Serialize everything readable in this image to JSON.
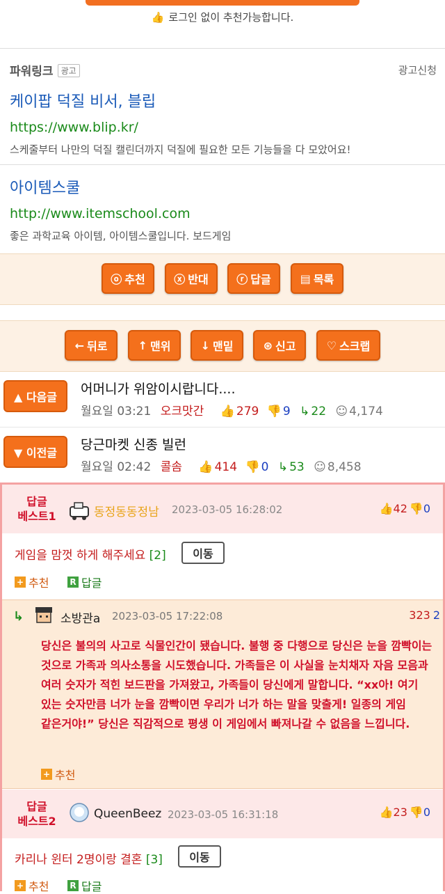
{
  "login_note": "로그인 없이 추천가능합니다.",
  "powerlink": {
    "title": "파워링크",
    "badge": "광고",
    "apply": "광고신청",
    "ads": [
      {
        "title": "케이팝 덕질 비서, 블립",
        "url": "https://www.blip.kr/",
        "desc": "스케줄부터 나만의 덕질 캘린더까지 덕질에 필요한 모든 기능들을 다 모았어요!"
      },
      {
        "title": "아이템스쿨",
        "url": "http://www.itemschool.com",
        "desc": "좋은 과학교육 아이템, 아이템스쿨입니다. 보드게임"
      }
    ]
  },
  "vote_buttons": [
    {
      "icon": "ⓞ",
      "label": "추천"
    },
    {
      "icon": "ⓧ",
      "label": "반대"
    },
    {
      "icon": "ⓡ",
      "label": "답글"
    },
    {
      "icon": "▤",
      "label": "목록"
    }
  ],
  "nav_buttons": [
    {
      "icon": "←",
      "label": "뒤로"
    },
    {
      "icon": "↑",
      "label": "맨위"
    },
    {
      "icon": "↓",
      "label": "맨밑"
    },
    {
      "icon": "⊛",
      "label": "신고"
    },
    {
      "icon": "♡",
      "label": "스크랩"
    }
  ],
  "next_post": {
    "button": "▲ 다음글",
    "title": "어머니가 위암이시랍니다....",
    "time": "월요일 03:21",
    "author": "오크맛간",
    "up": "279",
    "down": "9",
    "replies": "22",
    "views": "4,174"
  },
  "prev_post": {
    "button": "▼ 이전글",
    "title": "당근마켓 신종 빌런",
    "time": "월요일 02:42",
    "author": "콜솜",
    "up": "414",
    "down": "0",
    "replies": "53",
    "views": "8,458"
  },
  "best1": {
    "label": "답글 베스트1",
    "nick": "동정동동정남",
    "date": "2023-03-05 16:28:02",
    "up": "42",
    "down": "0",
    "text": "게임을 맘껏 하게 해주세요",
    "count": "[2]",
    "move": "이동",
    "recommend": "추천",
    "reply": "답글"
  },
  "best1_reply": {
    "nick": "소방관a",
    "date": "2023-03-05 17:22:08",
    "up": "323",
    "down": "2",
    "body": "당신은 불의의 사고로 식물인간이 됐습니다. 불행 중 다행으로 당신은 눈을 깜빡이는 것으로 가족과 의사소통을 시도했습니다. 가족들은 이 사실을 눈치채자 자음 모음과 여러 숫자가 적힌 보드판을 가져왔고, 가족들이 당신에게 말합니다. “xx아! 여기 있는 숫자만큼 너가 눈을 깜빡이면 우리가 너가 하는 말을 맞출게! 일종의 게임 같은거야!” 당신은 직감적으로 평생 이 게임에서 빠져나갈 수 없음을 느낍니다.",
    "recommend": "추천"
  },
  "best2": {
    "label": "답글 베스트2",
    "nick": "QueenBeez",
    "date": "2023-03-05 16:31:18",
    "up": "23",
    "down": "0",
    "text": "카리나 윈터 2명이랑 결혼",
    "count": "[3]",
    "move": "이동",
    "recommend": "추천",
    "reply": "답글"
  },
  "colors": {
    "accent": "#f4701c",
    "best_border": "#f4a2a2",
    "up": "#c41d1d",
    "down": "#1a3ec0",
    "reply": "#1a8a1a"
  }
}
